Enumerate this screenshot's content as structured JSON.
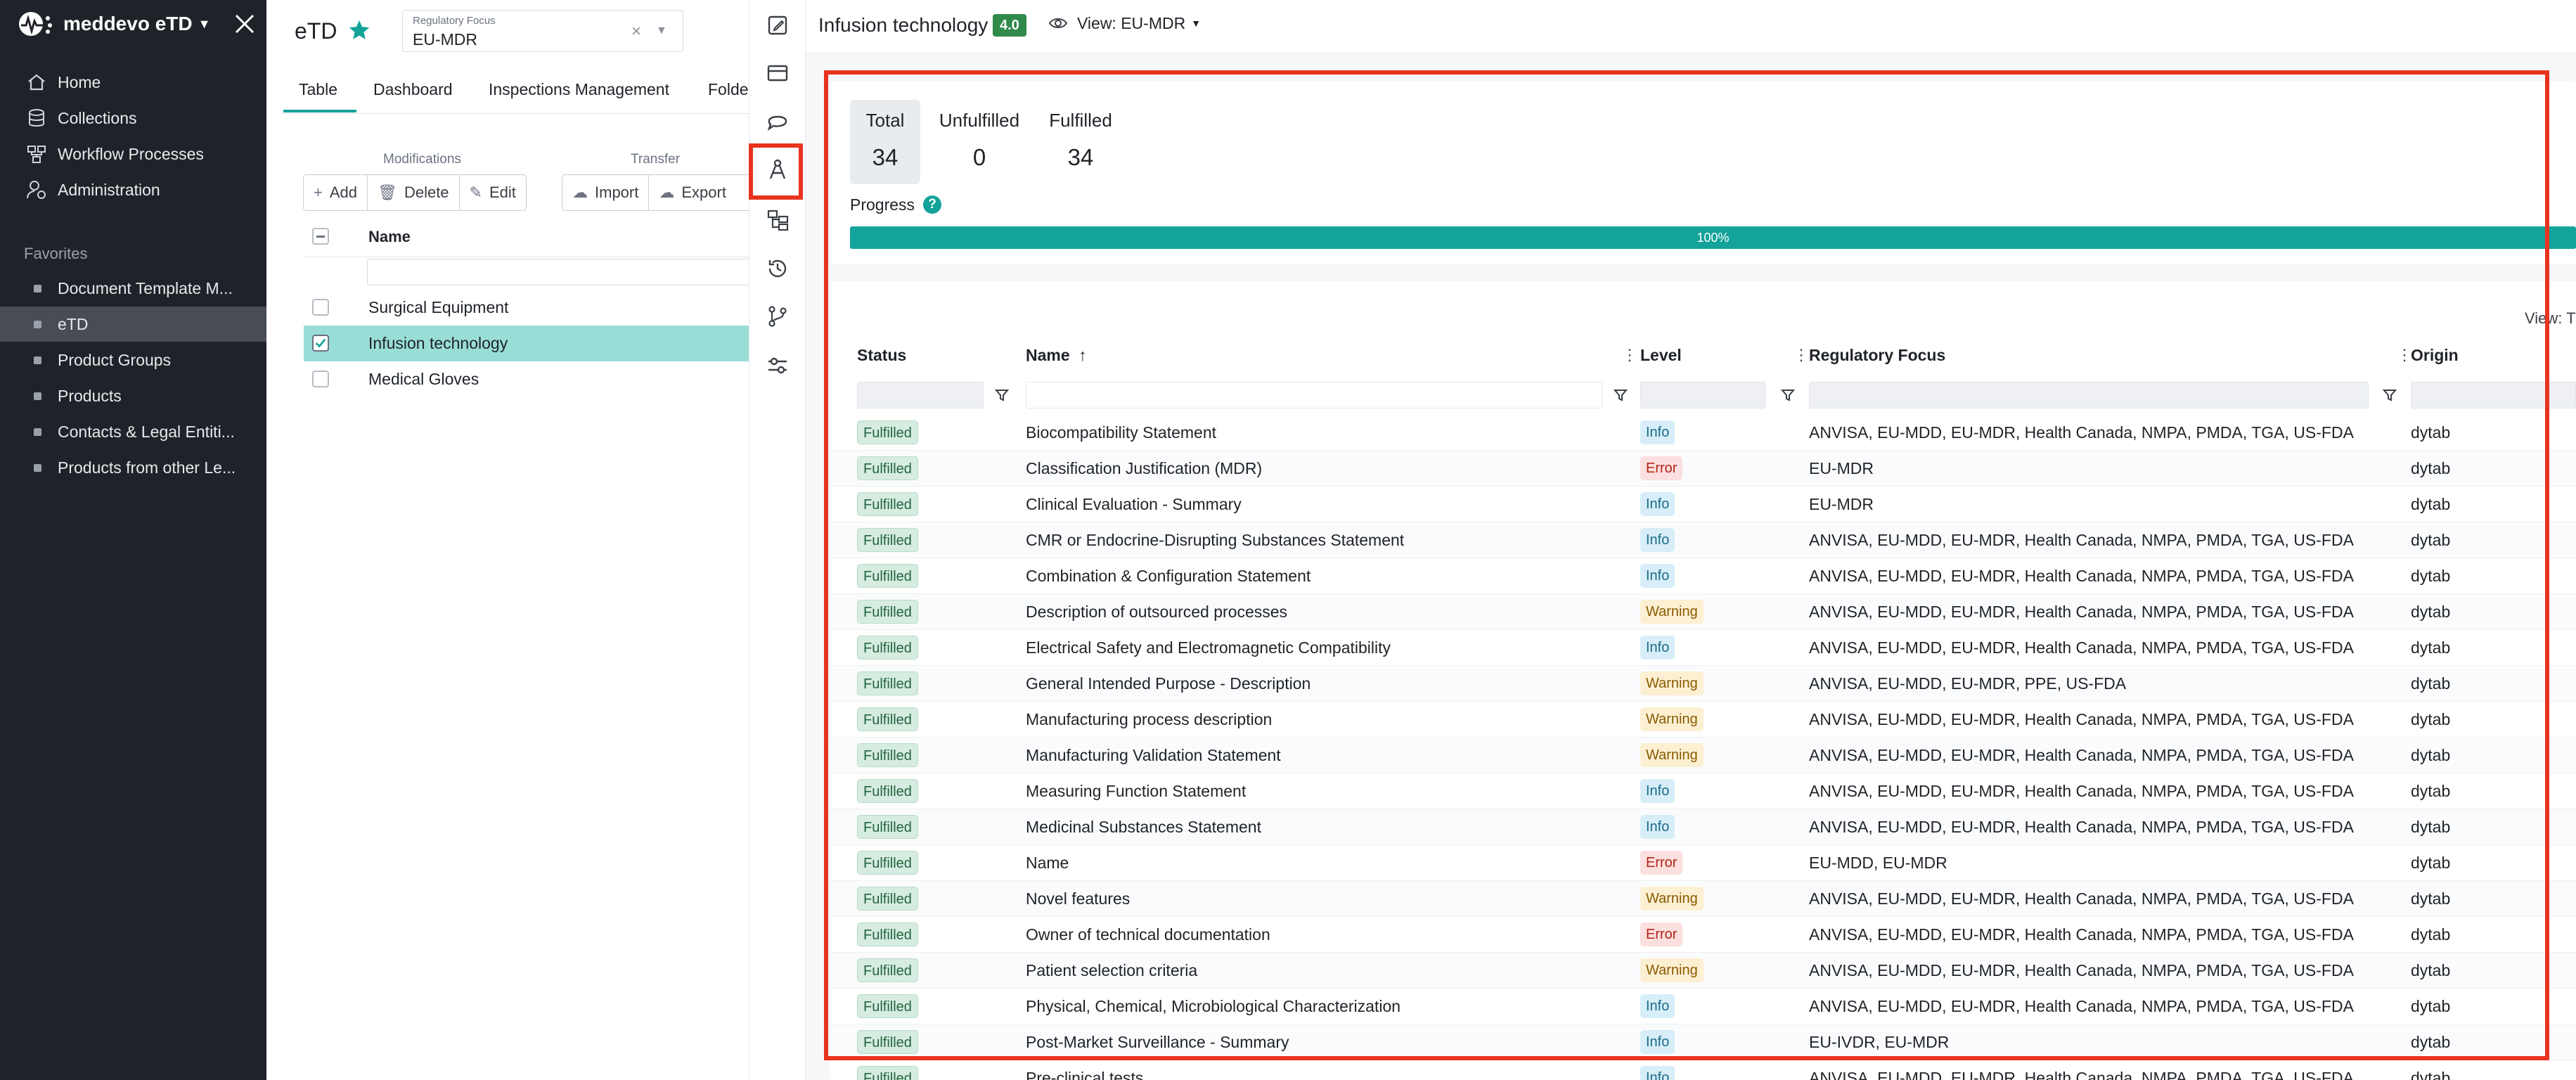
{
  "sidebar": {
    "app_title": "meddevo eTD",
    "nav": [
      {
        "label": "Home",
        "icon": "home-icon"
      },
      {
        "label": "Collections",
        "icon": "database-icon"
      },
      {
        "label": "Workflow Processes",
        "icon": "workflow-icon"
      },
      {
        "label": "Administration",
        "icon": "admin-icon"
      }
    ],
    "favorites_label": "Favorites",
    "favorites": [
      "Document Template M...",
      "eTD",
      "Product Groups",
      "Products",
      "Contacts & Legal Entiti...",
      "Products from other Le..."
    ],
    "active_favorite": "eTD"
  },
  "middle": {
    "title": "eTD",
    "regulatory_focus": {
      "label": "Regulatory Focus",
      "value": "EU-MDR"
    },
    "tabs": [
      "Table",
      "Dashboard",
      "Inspections Management",
      "Folde"
    ],
    "active_tab": "Table",
    "groups": {
      "modifications": "Modifications",
      "transfer": "Transfer"
    },
    "buttons": {
      "add": "Add",
      "delete": "Delete",
      "edit": "Edit",
      "import": "Import",
      "export": "Export"
    },
    "table_header": "Name",
    "rows": [
      {
        "name": "Surgical Equipment",
        "selected": false
      },
      {
        "name": "Infusion technology",
        "selected": true
      },
      {
        "name": "Medical Gloves",
        "selected": false
      }
    ]
  },
  "detail": {
    "title": "Infusion technology",
    "version": "4.0",
    "view": "View: EU-MDR",
    "stats": {
      "total_label": "Total",
      "total": "34",
      "unfulfilled_label": "Unfulfilled",
      "unfulfilled": "0",
      "fulfilled_label": "Fulfilled",
      "fulfilled": "34"
    },
    "progress_label": "Progress",
    "progress_help": "?",
    "progress_text": "100%",
    "progress_value": 1.0,
    "view_cutoff": "View: T",
    "columns": {
      "status": "Status",
      "name": "Name",
      "level": "Level",
      "regulatory_focus": "Regulatory Focus",
      "origin": "Origin"
    },
    "rows": [
      {
        "status": "Fulfilled",
        "name": "Biocompatibility Statement",
        "level": "Info",
        "focus": "ANVISA, EU-MDD, EU-MDR, Health Canada, NMPA, PMDA, TGA, US-FDA",
        "origin": "dytab"
      },
      {
        "status": "Fulfilled",
        "name": "Classification Justification (MDR)",
        "level": "Error",
        "focus": "EU-MDR",
        "origin": "dytab"
      },
      {
        "status": "Fulfilled",
        "name": "Clinical Evaluation - Summary",
        "level": "Info",
        "focus": "EU-MDR",
        "origin": "dytab"
      },
      {
        "status": "Fulfilled",
        "name": "CMR or Endocrine-Disrupting Substances Statement",
        "level": "Info",
        "focus": "ANVISA, EU-MDD, EU-MDR, Health Canada, NMPA, PMDA, TGA, US-FDA",
        "origin": "dytab"
      },
      {
        "status": "Fulfilled",
        "name": "Combination & Configuration Statement",
        "level": "Info",
        "focus": "ANVISA, EU-MDD, EU-MDR, Health Canada, NMPA, PMDA, TGA, US-FDA",
        "origin": "dytab"
      },
      {
        "status": "Fulfilled",
        "name": "Description of outsourced processes",
        "level": "Warning",
        "focus": "ANVISA, EU-MDD, EU-MDR, Health Canada, NMPA, PMDA, TGA, US-FDA",
        "origin": "dytab"
      },
      {
        "status": "Fulfilled",
        "name": "Electrical Safety and Electromagnetic Compatibility",
        "level": "Info",
        "focus": "ANVISA, EU-MDD, EU-MDR, Health Canada, NMPA, PMDA, TGA, US-FDA",
        "origin": "dytab"
      },
      {
        "status": "Fulfilled",
        "name": "General Intended Purpose - Description",
        "level": "Warning",
        "focus": "ANVISA, EU-MDD, EU-MDR, PPE, US-FDA",
        "origin": "dytab"
      },
      {
        "status": "Fulfilled",
        "name": "Manufacturing process description",
        "level": "Warning",
        "focus": "ANVISA, EU-MDD, EU-MDR, Health Canada, NMPA, PMDA, TGA, US-FDA",
        "origin": "dytab"
      },
      {
        "status": "Fulfilled",
        "name": "Manufacturing Validation Statement",
        "level": "Warning",
        "focus": "ANVISA, EU-MDD, EU-MDR, Health Canada, NMPA, PMDA, TGA, US-FDA",
        "origin": "dytab"
      },
      {
        "status": "Fulfilled",
        "name": "Measuring Function Statement",
        "level": "Info",
        "focus": "ANVISA, EU-MDD, EU-MDR, Health Canada, NMPA, PMDA, TGA, US-FDA",
        "origin": "dytab"
      },
      {
        "status": "Fulfilled",
        "name": "Medicinal Substances Statement",
        "level": "Info",
        "focus": "ANVISA, EU-MDD, EU-MDR, Health Canada, NMPA, PMDA, TGA, US-FDA",
        "origin": "dytab"
      },
      {
        "status": "Fulfilled",
        "name": "Name",
        "level": "Error",
        "focus": "EU-MDD, EU-MDR",
        "origin": "dytab"
      },
      {
        "status": "Fulfilled",
        "name": "Novel features",
        "level": "Warning",
        "focus": "ANVISA, EU-MDD, EU-MDR, Health Canada, NMPA, PMDA, TGA, US-FDA",
        "origin": "dytab"
      },
      {
        "status": "Fulfilled",
        "name": "Owner of technical documentation",
        "level": "Error",
        "focus": "ANVISA, EU-MDD, EU-MDR, Health Canada, NMPA, PMDA, TGA, US-FDA",
        "origin": "dytab"
      },
      {
        "status": "Fulfilled",
        "name": "Patient selection criteria",
        "level": "Warning",
        "focus": "ANVISA, EU-MDD, EU-MDR, Health Canada, NMPA, PMDA, TGA, US-FDA",
        "origin": "dytab"
      },
      {
        "status": "Fulfilled",
        "name": "Physical, Chemical, Microbiological Characterization",
        "level": "Info",
        "focus": "ANVISA, EU-MDD, EU-MDR, Health Canada, NMPA, PMDA, TGA, US-FDA",
        "origin": "dytab"
      },
      {
        "status": "Fulfilled",
        "name": "Post-Market Surveillance - Summary",
        "level": "Info",
        "focus": "EU-IVDR, EU-MDR",
        "origin": "dytab"
      },
      {
        "status": "Fulfilled",
        "name": "Pre-clinical tests",
        "level": "Info",
        "focus": "ANVISA, EU-MDD, EU-MDR, Health Canada, NMPA, PMDA, TGA, US-FDA",
        "origin": "dytab"
      }
    ]
  },
  "colors": {
    "accent": "#14a39a",
    "sidebar": "#1f2329",
    "highlight": "#e8331f",
    "version_badge": "#2f8a4b"
  }
}
